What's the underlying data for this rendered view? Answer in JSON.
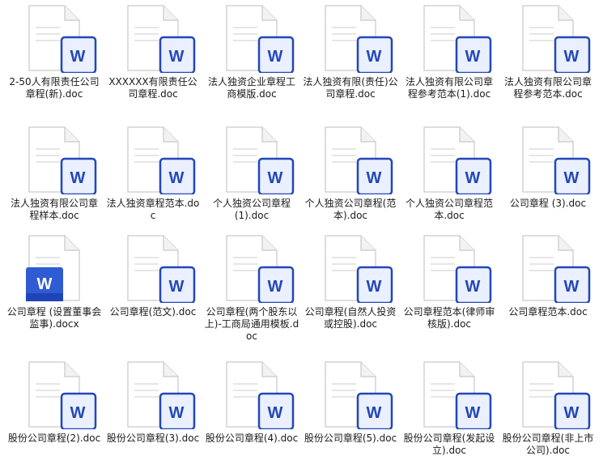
{
  "colors": {
    "word_blue": "#2f5bd3",
    "word_blue_dark": "#2347b8",
    "word_badge_fill": "#eaf0ff",
    "page_stroke": "#c9c9c9",
    "text": "#1a1a1a"
  },
  "files": [
    {
      "label": "2-50人有限责任公司章程(新).doc",
      "icon": "word-doc-icon",
      "style": "outline"
    },
    {
      "label": "XXXXXX有限责任公司章程.doc",
      "icon": "word-doc-icon",
      "style": "outline"
    },
    {
      "label": "法人独资企业章程工商模版.doc",
      "icon": "word-doc-icon",
      "style": "outline"
    },
    {
      "label": "法人独资有限(责任)公司章程.doc",
      "icon": "word-doc-icon",
      "style": "outline"
    },
    {
      "label": "法人独资有限公司章程参考范本(1).doc",
      "icon": "word-doc-icon",
      "style": "outline"
    },
    {
      "label": "法人独资有限公司章程参考范本.doc",
      "icon": "word-doc-icon",
      "style": "outline"
    },
    {
      "label": "法人独资有限公司章程样本.doc",
      "icon": "word-doc-icon",
      "style": "outline"
    },
    {
      "label": "法人独资章程范本.doc",
      "icon": "word-doc-icon",
      "style": "outline"
    },
    {
      "label": "个人独资公司章程 (1).doc",
      "icon": "word-doc-icon",
      "style": "outline"
    },
    {
      "label": "个人独资公司章程(范本).doc",
      "icon": "word-doc-icon",
      "style": "outline"
    },
    {
      "label": "个人独资公司章程范本.doc",
      "icon": "word-doc-icon",
      "style": "outline"
    },
    {
      "label": "公司章程 (3).doc",
      "icon": "word-doc-icon",
      "style": "outline"
    },
    {
      "label": "公司章程 (设置董事会监事).docx",
      "icon": "word-docx-icon",
      "style": "solid"
    },
    {
      "label": "公司章程(范文).doc",
      "icon": "word-doc-icon",
      "style": "outline"
    },
    {
      "label": "公司章程(两个股东以上)-工商局通用模板.doc",
      "icon": "word-doc-icon",
      "style": "outline"
    },
    {
      "label": "公司章程(自然人投资或控股).doc",
      "icon": "word-doc-icon",
      "style": "outline"
    },
    {
      "label": "公司章程范本(律师审核版).doc",
      "icon": "word-doc-icon",
      "style": "outline"
    },
    {
      "label": "公司章程范本.doc",
      "icon": "word-doc-icon",
      "style": "outline"
    },
    {
      "label": "股份公司章程(2).doc",
      "icon": "word-doc-icon",
      "style": "outline"
    },
    {
      "label": "股份公司章程(3).doc",
      "icon": "word-doc-icon",
      "style": "outline"
    },
    {
      "label": "股份公司章程(4).doc",
      "icon": "word-doc-icon",
      "style": "outline"
    },
    {
      "label": "股份公司章程(5).doc",
      "icon": "word-doc-icon",
      "style": "outline"
    },
    {
      "label": "股份公司章程(发起设立).doc",
      "icon": "word-doc-icon",
      "style": "outline"
    },
    {
      "label": "股份公司章程(非上市公司).doc",
      "icon": "word-doc-icon",
      "style": "outline"
    }
  ]
}
